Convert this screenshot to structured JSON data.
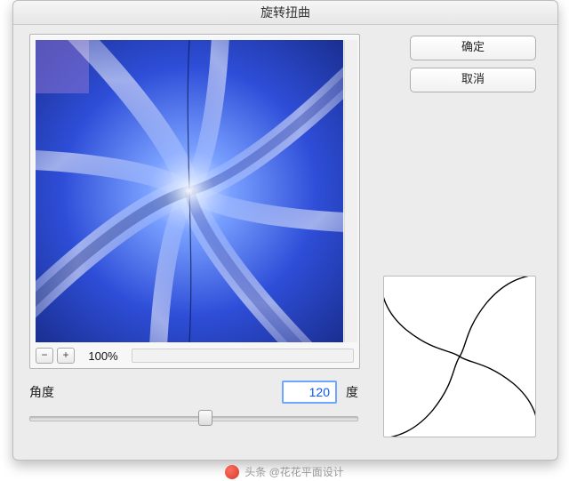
{
  "dialog": {
    "title": "旋转扭曲"
  },
  "buttons": {
    "ok": "确定",
    "cancel": "取消"
  },
  "zoom": {
    "minus": "−",
    "plus": "+",
    "value": "100%"
  },
  "angle": {
    "label": "角度",
    "value": "120",
    "unit": "度",
    "min": -999,
    "max": 999
  },
  "watermark": {
    "text": "头条 @花花平面设计"
  },
  "colors": {
    "preview_base": "#2a3c9e",
    "accent": "#6ea6ff"
  }
}
